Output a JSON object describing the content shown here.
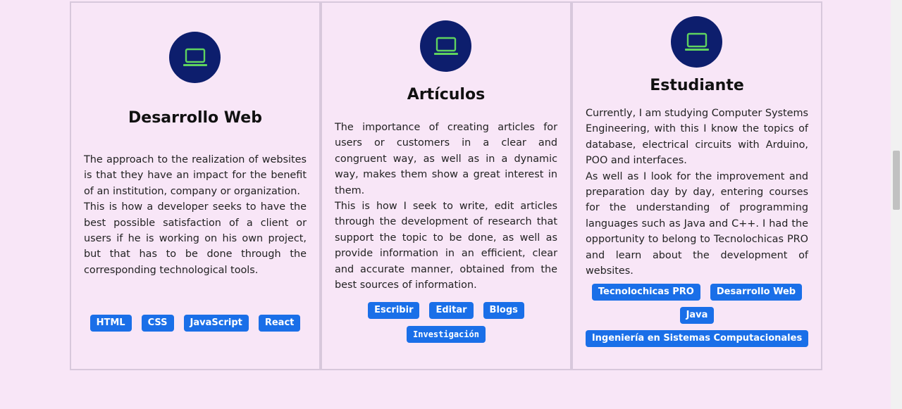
{
  "cards": [
    {
      "icon": "laptop-icon",
      "title": "Desarrollo Web",
      "paragraphs": [
        "The approach to the realization of websites is that they have an impact for the benefit of an institution, company or organization.",
        "This is how a developer seeks to have the best possible satisfaction of a client or users if he is working on his own project, but that has to be done through the corresponding technological tools."
      ],
      "tags": [
        "HTML",
        "CSS",
        "JavaScript",
        "React"
      ]
    },
    {
      "icon": "laptop-icon",
      "title": "Artículos",
      "paragraphs": [
        "The importance of creating articles for users or customers in a clear and congruent way, as well as in a dynamic way, makes them show a great interest in them.",
        "This is how I seek to write, edit articles through the development of research that support the topic to be done, as well as provide information in an efficient, clear and accurate manner, obtained from the best sources of information."
      ],
      "tags": [
        "Escribir",
        "Editar",
        "Blogs",
        "Investigación"
      ]
    },
    {
      "icon": "laptop-icon",
      "title": "Estudiante",
      "paragraphs": [
        "Currently, I am studying Computer Systems Engineering, with this I know the topics of database, electrical circuits with Arduino, POO and interfaces.",
        "As well as I look for the improvement and preparation day by day, entering courses for the understanding of programming languages such as Java and C++. I had the opportunity to belong to Tecnolochicas PRO and learn about the development of websites."
      ],
      "tags": [
        "Tecnolochicas PRO",
        "Desarrollo Web",
        "Java",
        "Ingeniería en Sistemas Computacionales"
      ]
    }
  ],
  "colors": {
    "background": "#f8e6f7",
    "icon_circle": "#0d1e6d",
    "icon_stroke": "#5fd35f",
    "tag": "#1a6fe8"
  }
}
